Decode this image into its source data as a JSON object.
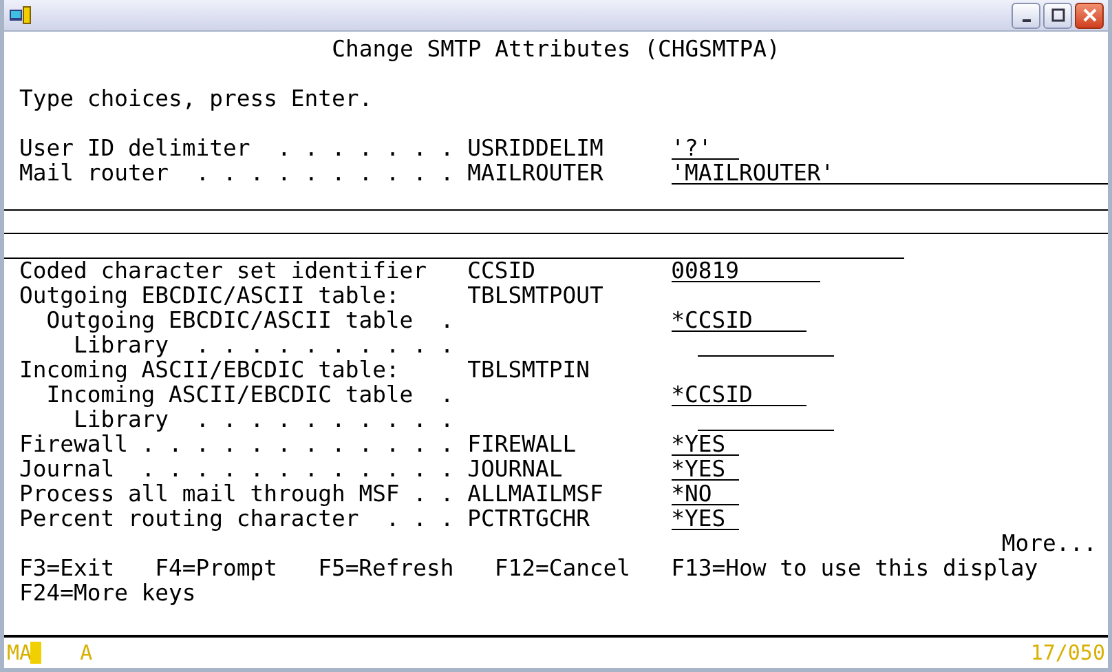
{
  "screen": {
    "title": "Change SMTP Attributes (CHGSMTPA)",
    "instruction": "Type choices, press Enter.",
    "fields": [
      {
        "label": "User ID delimiter  . . . . . . .",
        "keyword": "USRIDDELIM",
        "value": "'?'",
        "kind": "short"
      },
      {
        "label": "Mail router  . . . . . . . . . .",
        "keyword": "MAILROUTER",
        "value": "'MAILROUTER'",
        "kind": "long"
      },
      {
        "label": "Coded character set identifier",
        "keyword": "CCSID",
        "value": "00819",
        "kind": "medium"
      },
      {
        "label": "Outgoing EBCDIC/ASCII table:",
        "keyword": "TBLSMTPOUT",
        "kind": "group",
        "children": [
          {
            "label": "Outgoing EBCDIC/ASCII table  .",
            "value": "*CCSID",
            "kind": "table",
            "children": [
              {
                "label": "Library  . . . . . . . . . .",
                "kind": "table"
              }
            ]
          }
        ]
      },
      {
        "label": "Incoming ASCII/EBCDIC table:",
        "keyword": "TBLSMTPIN",
        "kind": "group",
        "children": [
          {
            "label": "Incoming ASCII/EBCDIC table  .",
            "value": "*CCSID",
            "kind": "table",
            "children": [
              {
                "label": "Library  . . . . . . . . . .",
                "kind": "table"
              }
            ]
          }
        ]
      },
      {
        "label": "Firewall . . . . . . . . . . . .",
        "keyword": "FIREWALL",
        "value": "*YES",
        "kind": "short"
      },
      {
        "label": "Journal  . . . . . . . . . . . .",
        "keyword": "JOURNAL",
        "value": "*YES",
        "kind": "short"
      },
      {
        "label": "Process all mail through MSF . .",
        "keyword": "ALLMAILMSF",
        "value": "*NO",
        "kind": "short"
      },
      {
        "label": "Percent routing character  . . .",
        "keyword": "PCTRTGCHR",
        "value": "*YES",
        "kind": "short"
      }
    ],
    "more": "More...",
    "function_keys": [
      "F3=Exit",
      "F4=Prompt",
      "F5=Refresh",
      "F12=Cancel",
      "F13=How to use this display",
      "F24=More keys"
    ]
  },
  "status_bar": {
    "mode": "MA",
    "indicator": "A",
    "cursor_position": "17/050"
  }
}
